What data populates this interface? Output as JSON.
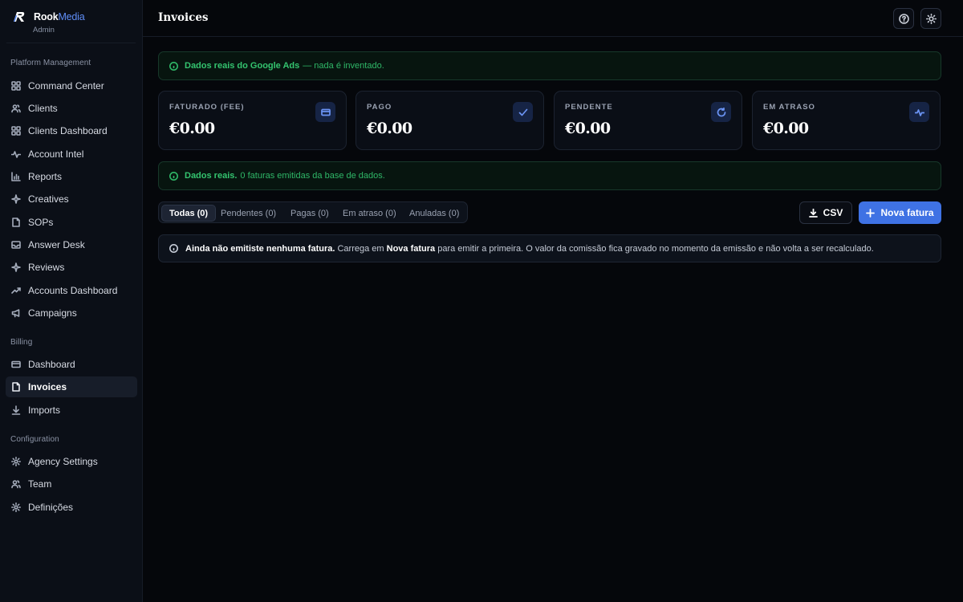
{
  "brand": {
    "name_main": "Rook",
    "name_accent": "Media",
    "role": "Admin",
    "accent_color": "#5f8df7"
  },
  "sidebar": {
    "sections": [
      {
        "label": "Platform Management"
      },
      {
        "label": "Billing"
      },
      {
        "label": "Configuration"
      }
    ],
    "items": [
      {
        "label": "Command Center",
        "icon": "grid-icon"
      },
      {
        "label": "Clients",
        "icon": "users-icon"
      },
      {
        "label": "Clients Dashboard",
        "icon": "grid-icon"
      },
      {
        "label": "Account Intel",
        "icon": "activity-icon"
      },
      {
        "label": "Reports",
        "icon": "bar-chart-icon"
      },
      {
        "label": "Creatives",
        "icon": "sparkle-icon"
      },
      {
        "label": "SOPs",
        "icon": "file-icon"
      },
      {
        "label": "Answer Desk",
        "icon": "inbox-icon"
      },
      {
        "label": "Reviews",
        "icon": "sparkle-icon"
      },
      {
        "label": "Accounts Dashboard",
        "icon": "trending-icon"
      },
      {
        "label": "Campaigns",
        "icon": "megaphone-icon"
      },
      {
        "label": "Dashboard",
        "icon": "card-icon"
      },
      {
        "label": "Invoices",
        "icon": "file-icon",
        "active": true
      },
      {
        "label": "Imports",
        "icon": "download-icon"
      },
      {
        "label": "Agency Settings",
        "icon": "gear-icon"
      },
      {
        "label": "Team",
        "icon": "users-icon"
      },
      {
        "label": "Definições",
        "icon": "gear-icon"
      }
    ]
  },
  "header": {
    "title": "Invoices"
  },
  "alerts": {
    "google_ads": {
      "bold": "Dados reais do Google Ads",
      "text": "— nada é inventado."
    },
    "db": {
      "bold": "Dados reais.",
      "text": "0 faturas emitidas da base de dados."
    }
  },
  "cards": [
    {
      "label": "FATURADO (FEE)",
      "value": "€0.00",
      "icon": "credit-card-icon"
    },
    {
      "label": "PAGO",
      "value": "€0.00",
      "icon": "check-icon"
    },
    {
      "label": "PENDENTE",
      "value": "€0.00",
      "icon": "refresh-icon"
    },
    {
      "label": "EM ATRASO",
      "value": "€0.00",
      "icon": "activity-icon"
    }
  ],
  "tabs": [
    {
      "label": "Todas (0)",
      "active": true
    },
    {
      "label": "Pendentes (0)"
    },
    {
      "label": "Pagas (0)"
    },
    {
      "label": "Em atraso (0)"
    },
    {
      "label": "Anuladas (0)"
    }
  ],
  "actions": {
    "csv": "CSV",
    "new_invoice": "Nova fatura"
  },
  "info": {
    "bold1": "Ainda não emitiste nenhuma fatura.",
    "text1": "Carrega em",
    "bold2": "Nova fatura",
    "text2": "para emitir a primeira. O valor da comissão fica gravado no momento da emissão e não volta a ser recalculado."
  },
  "colors": {
    "primary": "#3f72e4",
    "success": "#2fb868",
    "background": "#05070b",
    "sidebar": "#0b0f17"
  }
}
